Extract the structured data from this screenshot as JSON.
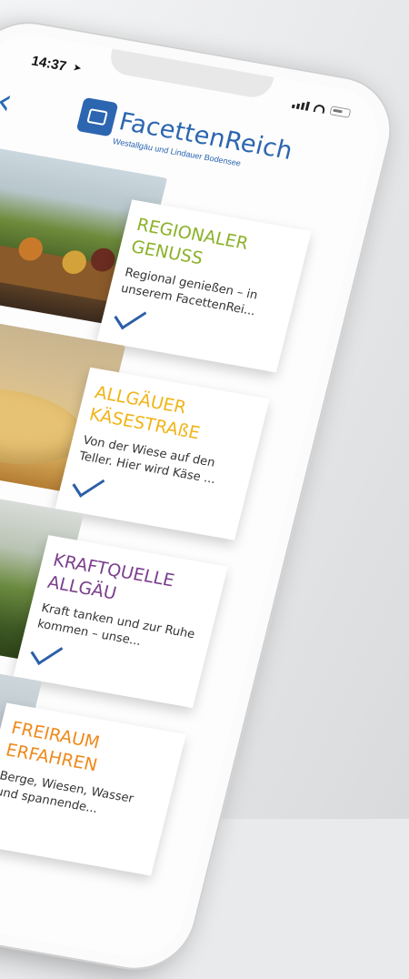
{
  "status_bar": {
    "time": "14:37",
    "location_arrow": "➤"
  },
  "header": {
    "back_icon": "‹",
    "logo_text": "FacettenReich",
    "logo_subtitle": "Westallgäu und Lindauer Bodensee"
  },
  "colors": {
    "brand_blue": "#2c66b0",
    "green": "#8cb22a",
    "yellow": "#f0b518",
    "purple": "#7b3f8c",
    "orange": "#ef8a1c"
  },
  "cards": [
    {
      "title_line1": "REGIONALER",
      "title_line2": "GENUSS",
      "color": "#8cb22a",
      "desc": "Regional genießen – in unserem FacettenRei..."
    },
    {
      "title_line1": "ALLGÄUER",
      "title_line2": "KÄSESTRAßE",
      "color": "#f0b518",
      "desc": "Von der Wiese auf den Teller. Hier wird Käse ..."
    },
    {
      "title_line1": "KRAFTQUELLE",
      "title_line2": "ALLGÄU",
      "color": "#7b3f8c",
      "desc": "Kraft tanken und zur Ruhe kommen – unse..."
    },
    {
      "title_line1": "FREIRAUM",
      "title_line2": "ERFAHREN",
      "color": "#ef8a1c",
      "desc": "Berge, Wiesen, Wasser und spannende..."
    }
  ]
}
